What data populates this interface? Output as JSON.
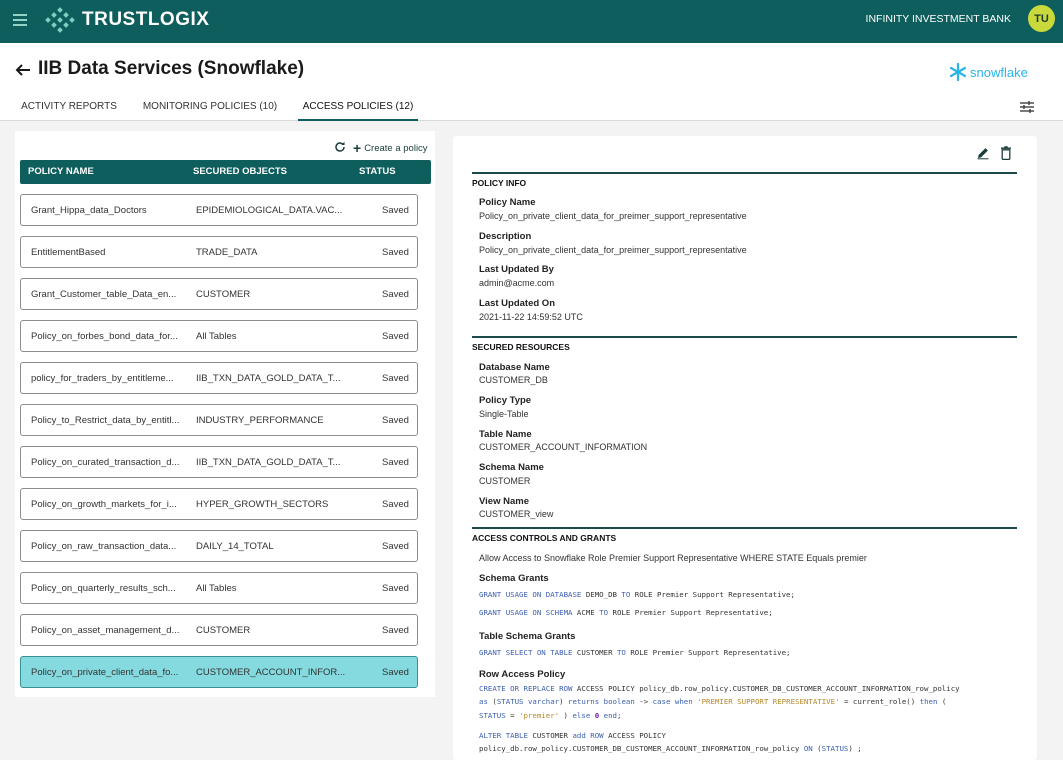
{
  "header": {
    "app_name": "TRUSTLOGIX",
    "org_name": "INFINITY INVESTMENT BANK",
    "avatar_initials": "TU"
  },
  "page": {
    "title": "IIB Data Services (Snowflake)",
    "platform_logo_text": "snowflake"
  },
  "tabs": [
    {
      "label": "ACTIVITY REPORTS",
      "active": false
    },
    {
      "label": "MONITORING POLICIES (10)",
      "active": false
    },
    {
      "label": "ACCESS POLICIES (12)",
      "active": true
    }
  ],
  "toolbar": {
    "create_policy_label": "Create a policy"
  },
  "policy_table": {
    "columns": [
      "POLICY NAME",
      "SECURED OBJECTS",
      "STATUS"
    ],
    "rows": [
      {
        "name": "Grant_Hippa_data_Doctors",
        "objects": "EPIDEMIOLOGICAL_DATA.VAC...",
        "status": "Saved"
      },
      {
        "name": "EntitlementBased",
        "objects": "TRADE_DATA",
        "status": "Saved"
      },
      {
        "name": "Grant_Customer_table_Data_en...",
        "objects": "CUSTOMER",
        "status": "Saved"
      },
      {
        "name": "Policy_on_forbes_bond_data_for...",
        "objects": "All Tables",
        "status": "Saved"
      },
      {
        "name": "policy_for_traders_by_entitleme...",
        "objects": "IIB_TXN_DATA_GOLD_DATA_T...",
        "status": "Saved"
      },
      {
        "name": "Policy_to_Restrict_data_by_entitl...",
        "objects": "INDUSTRY_PERFORMANCE",
        "status": "Saved"
      },
      {
        "name": "Policy_on_curated_transaction_d...",
        "objects": "IIB_TXN_DATA_GOLD_DATA_T...",
        "status": "Saved"
      },
      {
        "name": "Policy_on_growth_markets_for_i...",
        "objects": "HYPER_GROWTH_SECTORS",
        "status": "Saved"
      },
      {
        "name": "Policy_on_raw_transaction_data...",
        "objects": "DAILY_14_TOTAL",
        "status": "Saved"
      },
      {
        "name": "Policy_on_quarterly_results_sch...",
        "objects": "All Tables",
        "status": "Saved"
      },
      {
        "name": "Policy_on_asset_management_d...",
        "objects": "CUSTOMER",
        "status": "Saved"
      },
      {
        "name": "Policy_on_private_client_data_fo...",
        "objects": "CUSTOMER_ACCOUNT_INFOR...",
        "status": "Saved",
        "selected": true
      }
    ]
  },
  "details": {
    "policy_info": {
      "title": "POLICY INFO",
      "policy_name_label": "Policy Name",
      "policy_name": "Policy_on_private_client_data_for_preimer_support_representative",
      "description_label": "Description",
      "description": "Policy_on_private_client_data_for_preimer_support_representative",
      "last_updated_by_label": "Last Updated By",
      "last_updated_by": "admin@acme.com",
      "last_updated_on_label": "Last Updated On",
      "last_updated_on": "2021-11-22 14:59:52 UTC"
    },
    "secured_resources": {
      "title": "SECURED RESOURCES",
      "database_label": "Database Name",
      "database": "CUSTOMER_DB",
      "policy_type_label": "Policy Type",
      "policy_type": "Single-Table",
      "table_label": "Table Name",
      "table": "CUSTOMER_ACCOUNT_INFORMATION",
      "schema_label": "Schema Name",
      "schema": "CUSTOMER",
      "view_label": "View Name",
      "view": "CUSTOMER_view"
    },
    "access_controls": {
      "title": "ACCESS CONTROLS AND GRANTS",
      "summary": "Allow Access to Snowflake Role Premier Support Representative WHERE STATE Equals premier",
      "schema_grants_label": "Schema Grants",
      "schema_grant_1": "GRANT USAGE ON DATABASE DEMO_DB TO ROLE Premier Support Representative;",
      "schema_grant_2": "GRANT USAGE ON SCHEMA ACME TO ROLE Premier Support Representative;",
      "table_schema_grants_label": "Table Schema Grants",
      "table_schema_grant_1": "GRANT SELECT ON TABLE CUSTOMER TO ROLE Premier Support Representative;",
      "row_access_policy_label": "Row Access Policy",
      "rap_line_1": "CREATE OR REPLACE ROW ACCESS POLICY policy_db.row_policy.CUSTOMER_DB_CUSTOMER_ACCOUNT_INFORMATION_row_policy",
      "rap_line_2": "as (STATUS varchar) returns boolean -> case when 'PREMIER SUPPORT REPRESENTATIVE' = current_role() then (",
      "rap_line_3": "STATUS = 'premier' ) else 0 end;",
      "rap_line_4": "ALTER TABLE CUSTOMER add ROW ACCESS POLICY",
      "rap_line_5": "policy_db.row_policy.CUSTOMER_DB_CUSTOMER_ACCOUNT_INFORMATION_row_policy ON (STATUS) ;"
    }
  },
  "colors": {
    "brand": "#0d5e5c",
    "selected_row": "#84dadf",
    "avatar": "#c9d83a",
    "snowflake": "#29b5e8",
    "sql_keyword": "#3b5fb0"
  }
}
